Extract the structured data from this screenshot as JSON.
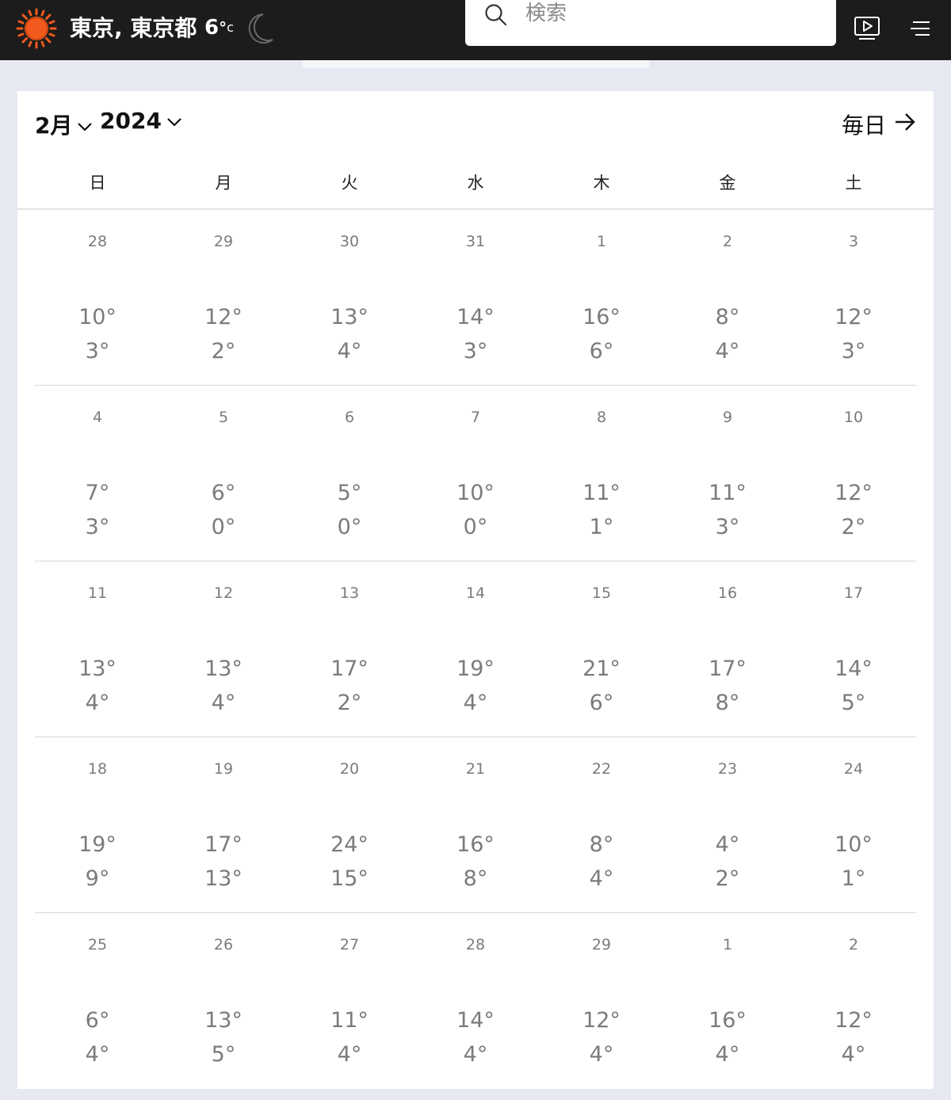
{
  "header": {
    "location": "東京, 東京都",
    "temperature": "6",
    "temp_degree": "°",
    "temp_unit": "c",
    "weather_icon": "sun-icon",
    "night_icon": "moon-icon",
    "brand_color": "#f25a1d",
    "search": {
      "placeholder": "検索",
      "value": ""
    },
    "video_icon": "video-play-icon",
    "menu_icon": "hamburger-menu-icon"
  },
  "calendar": {
    "month": "2月",
    "year": "2024",
    "daily_link": "毎日",
    "weekdays": [
      "日",
      "月",
      "火",
      "水",
      "木",
      "金",
      "土"
    ],
    "weeks": [
      [
        {
          "date": "28",
          "hi": "10°",
          "lo": "3°"
        },
        {
          "date": "29",
          "hi": "12°",
          "lo": "2°"
        },
        {
          "date": "30",
          "hi": "13°",
          "lo": "4°"
        },
        {
          "date": "31",
          "hi": "14°",
          "lo": "3°"
        },
        {
          "date": "1",
          "hi": "16°",
          "lo": "6°"
        },
        {
          "date": "2",
          "hi": "8°",
          "lo": "4°"
        },
        {
          "date": "3",
          "hi": "12°",
          "lo": "3°"
        }
      ],
      [
        {
          "date": "4",
          "hi": "7°",
          "lo": "3°"
        },
        {
          "date": "5",
          "hi": "6°",
          "lo": "0°"
        },
        {
          "date": "6",
          "hi": "5°",
          "lo": "0°"
        },
        {
          "date": "7",
          "hi": "10°",
          "lo": "0°"
        },
        {
          "date": "8",
          "hi": "11°",
          "lo": "1°"
        },
        {
          "date": "9",
          "hi": "11°",
          "lo": "3°"
        },
        {
          "date": "10",
          "hi": "12°",
          "lo": "2°"
        }
      ],
      [
        {
          "date": "11",
          "hi": "13°",
          "lo": "4°"
        },
        {
          "date": "12",
          "hi": "13°",
          "lo": "4°"
        },
        {
          "date": "13",
          "hi": "17°",
          "lo": "2°"
        },
        {
          "date": "14",
          "hi": "19°",
          "lo": "4°"
        },
        {
          "date": "15",
          "hi": "21°",
          "lo": "6°"
        },
        {
          "date": "16",
          "hi": "17°",
          "lo": "8°"
        },
        {
          "date": "17",
          "hi": "14°",
          "lo": "5°"
        }
      ],
      [
        {
          "date": "18",
          "hi": "19°",
          "lo": "9°"
        },
        {
          "date": "19",
          "hi": "17°",
          "lo": "13°"
        },
        {
          "date": "20",
          "hi": "24°",
          "lo": "15°"
        },
        {
          "date": "21",
          "hi": "16°",
          "lo": "8°"
        },
        {
          "date": "22",
          "hi": "8°",
          "lo": "4°"
        },
        {
          "date": "23",
          "hi": "4°",
          "lo": "2°"
        },
        {
          "date": "24",
          "hi": "10°",
          "lo": "1°"
        }
      ],
      [
        {
          "date": "25",
          "hi": "6°",
          "lo": "4°"
        },
        {
          "date": "26",
          "hi": "13°",
          "lo": "5°"
        },
        {
          "date": "27",
          "hi": "11°",
          "lo": "4°"
        },
        {
          "date": "28",
          "hi": "14°",
          "lo": "4°"
        },
        {
          "date": "29",
          "hi": "12°",
          "lo": "4°"
        },
        {
          "date": "1",
          "hi": "16°",
          "lo": "4°"
        },
        {
          "date": "2",
          "hi": "12°",
          "lo": "4°"
        }
      ]
    ]
  }
}
